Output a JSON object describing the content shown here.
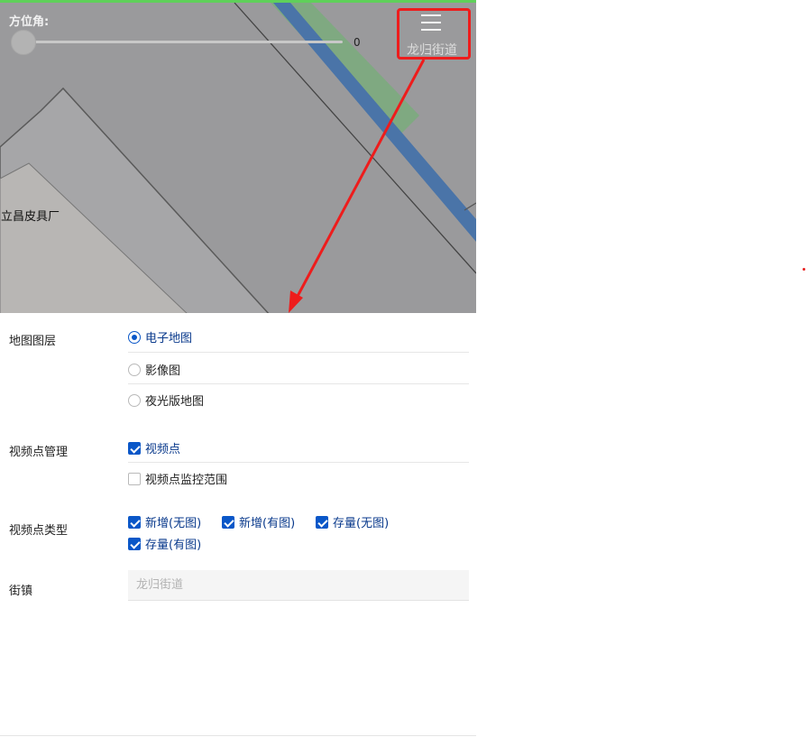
{
  "map": {
    "azimuth_label": "方位角:",
    "azimuth_value": "0",
    "place_label": "立昌皮具厂",
    "menu_icon": "hamburger-menu-icon",
    "current_street": "龙归街道",
    "colors": {
      "background": "#9a9a9c",
      "road_blue": "#4a74a8",
      "green_zone": "#7aab7c",
      "highlight_red": "#ee1c1c"
    }
  },
  "form": {
    "map_layer": {
      "label": "地图图层",
      "options": [
        {
          "label": "电子地图",
          "checked": true
        },
        {
          "label": "影像图",
          "checked": false
        },
        {
          "label": "夜光版地图",
          "checked": false
        }
      ]
    },
    "video_mgmt": {
      "label": "视频点管理",
      "options": [
        {
          "label": "视频点",
          "checked": true
        },
        {
          "label": "视频点监控范围",
          "checked": false
        }
      ]
    },
    "video_type": {
      "label": "视频点类型",
      "options": [
        {
          "label": "新增(无图)",
          "checked": true
        },
        {
          "label": "新增(有图)",
          "checked": true
        },
        {
          "label": "存量(无图)",
          "checked": true
        },
        {
          "label": "存量(有图)",
          "checked": true
        }
      ]
    },
    "street": {
      "label": "街镇",
      "placeholder": "龙归街道"
    }
  }
}
